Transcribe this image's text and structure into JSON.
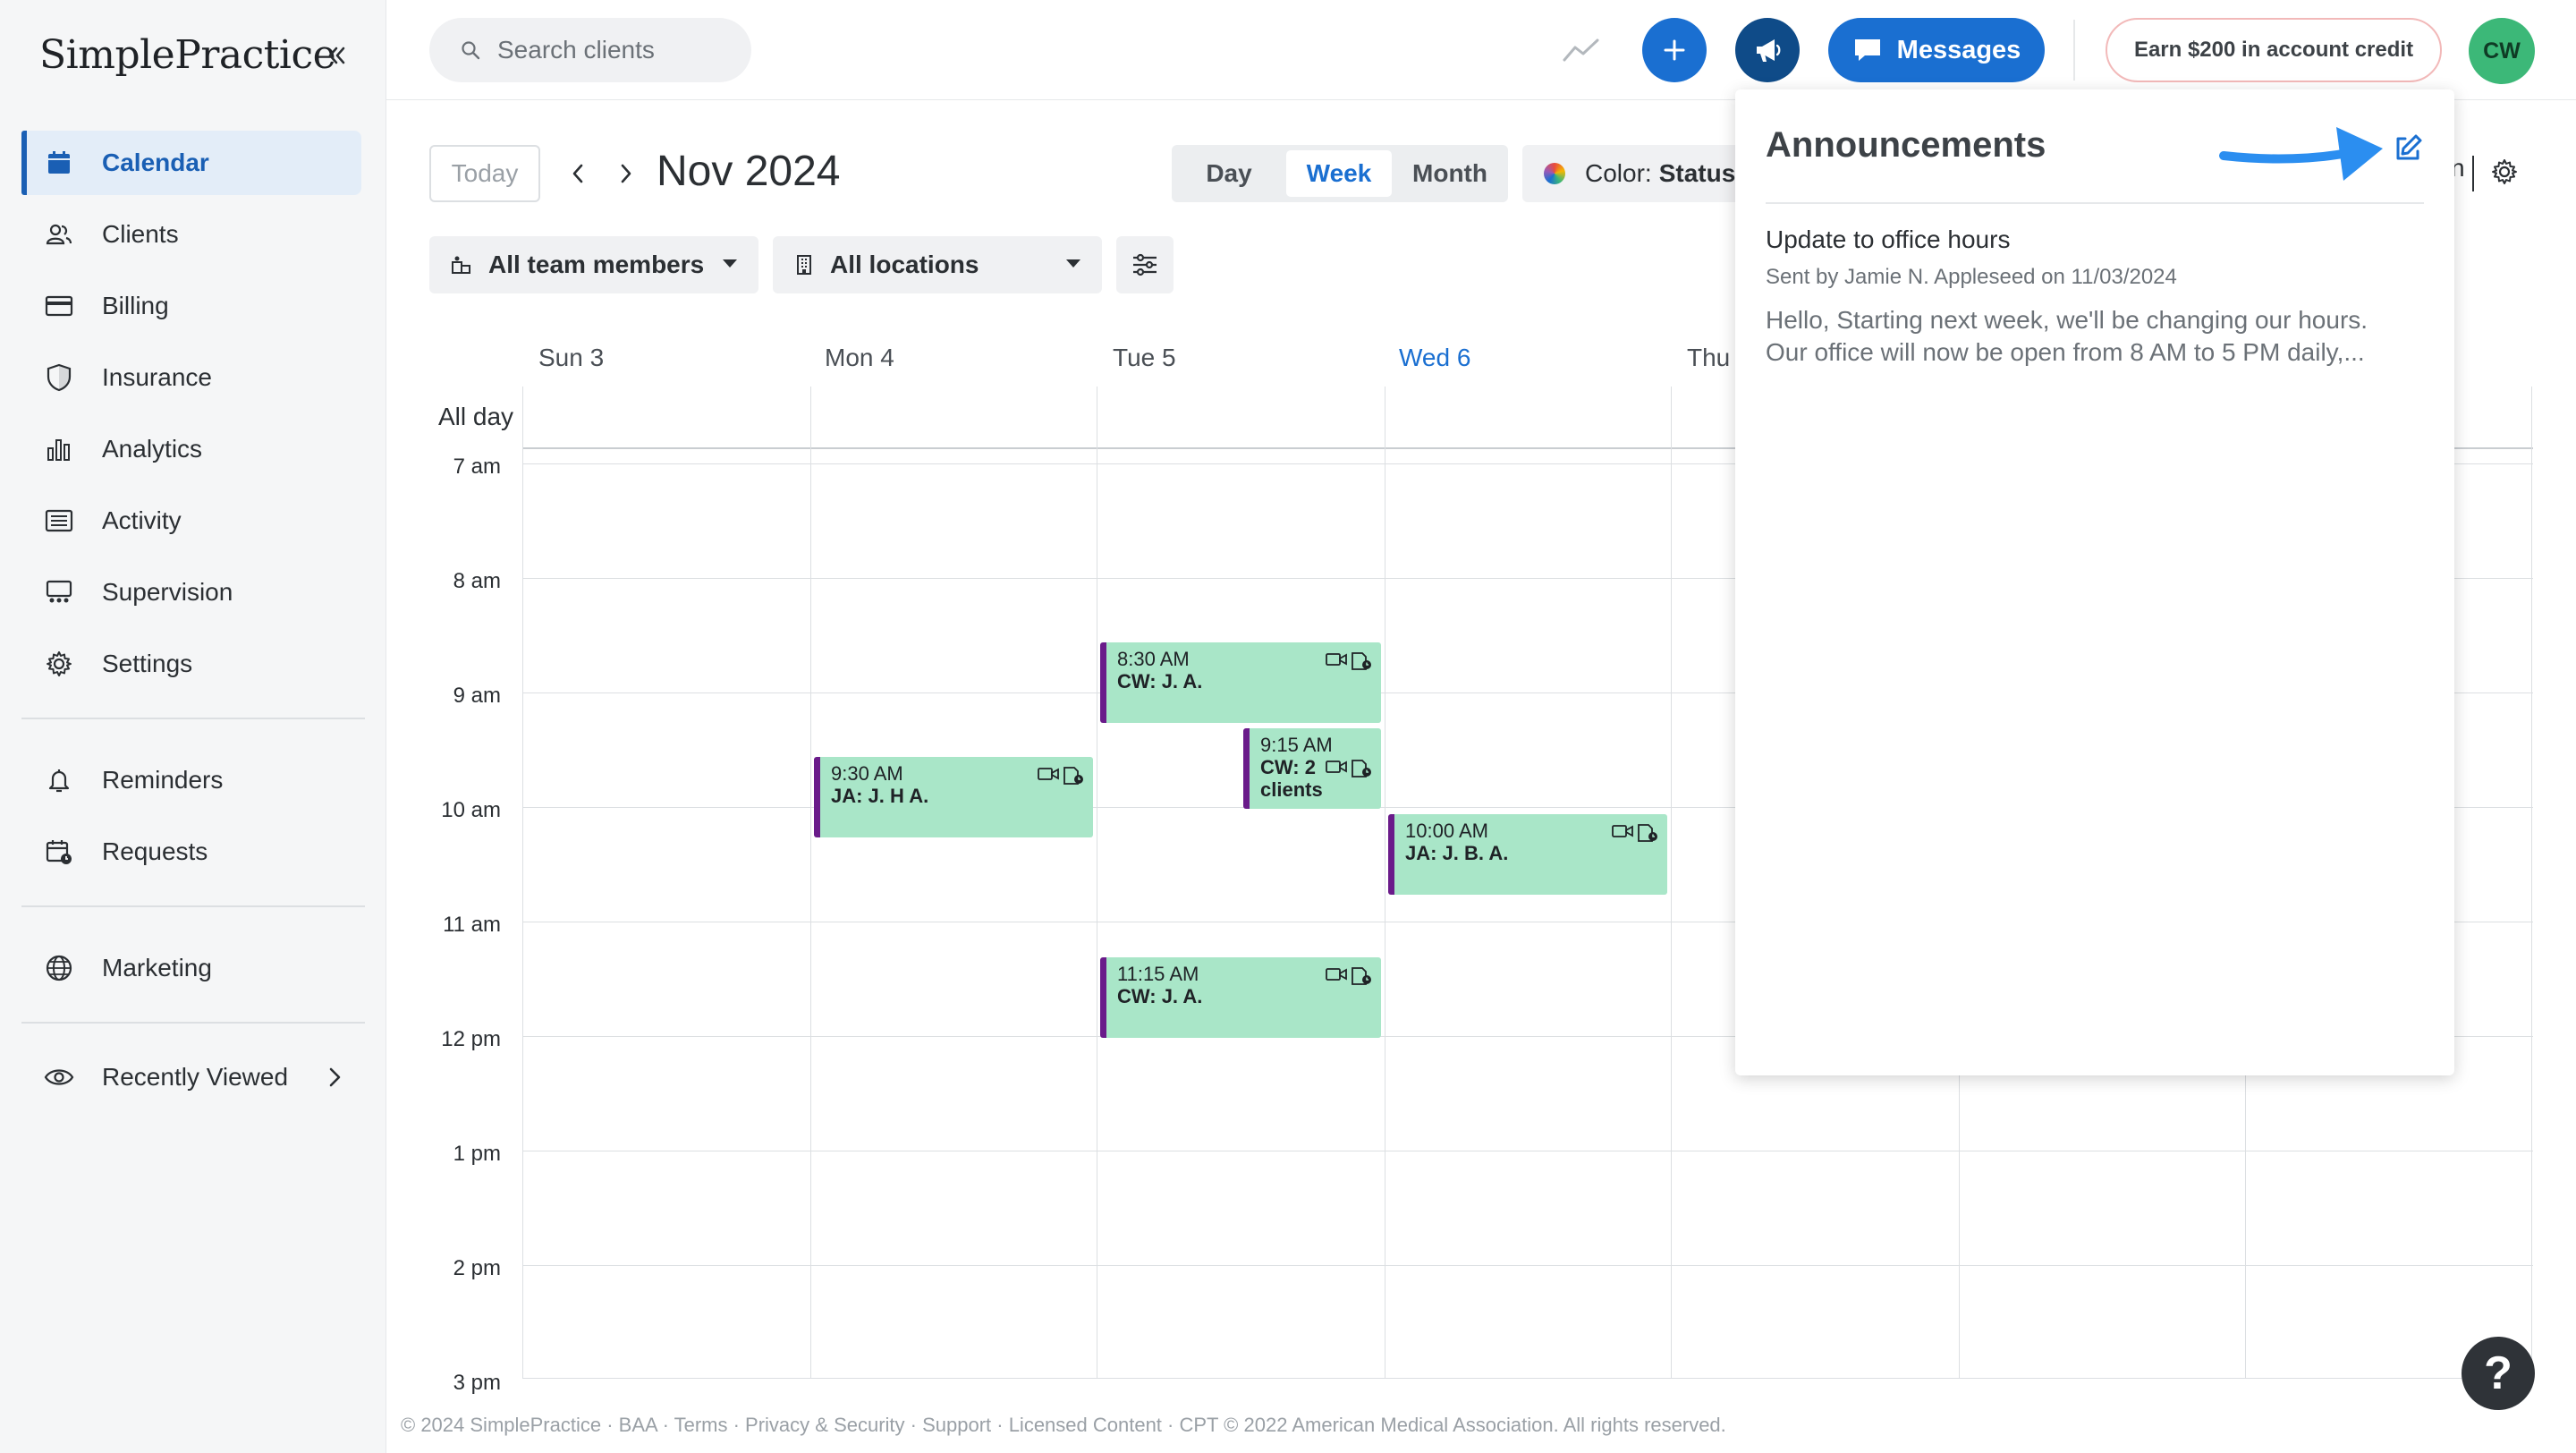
{
  "app": {
    "logo_text": "SimplePractice"
  },
  "sidebar": {
    "items": [
      {
        "label": "Calendar",
        "icon": "calendar-icon",
        "active": true
      },
      {
        "label": "Clients",
        "icon": "clients-icon"
      },
      {
        "label": "Billing",
        "icon": "billing-icon"
      },
      {
        "label": "Insurance",
        "icon": "shield-icon"
      },
      {
        "label": "Analytics",
        "icon": "bar-chart-icon"
      },
      {
        "label": "Activity",
        "icon": "list-icon"
      },
      {
        "label": "Supervision",
        "icon": "supervision-icon"
      },
      {
        "label": "Settings",
        "icon": "gear-icon"
      },
      {
        "label": "Reminders",
        "icon": "bell-icon"
      },
      {
        "label": "Requests",
        "icon": "calendar-request-icon"
      },
      {
        "label": "Marketing",
        "icon": "globe-icon"
      },
      {
        "label": "Recently Viewed",
        "icon": "eye-icon"
      }
    ]
  },
  "topbar": {
    "search_placeholder": "Search clients",
    "messages_label": "Messages",
    "credit_label": "Earn $200 in account credit",
    "avatar_initials": "CW"
  },
  "toolbar": {
    "today_label": "Today",
    "month_title": "Nov 2024",
    "views": [
      "Day",
      "Week",
      "Month"
    ],
    "active_view": "Week",
    "color_label": "Color:",
    "color_value": "Status",
    "team_filter": "All team members",
    "location_filter": "All locations",
    "partial_right_text": "n"
  },
  "calendar": {
    "days": [
      "Sun 3",
      "Mon 4",
      "Tue 5",
      "Wed 6",
      "Thu"
    ],
    "today": "Wed 6",
    "allday_label": "All day",
    "hours": [
      "7 am",
      "8 am",
      "9 am",
      "10 am",
      "11 am",
      "12 pm",
      "1 pm",
      "2 pm",
      "3 pm"
    ],
    "events": [
      {
        "time": "8:30 AM",
        "who": "CW: J. A."
      },
      {
        "time": "9:15 AM",
        "who": "CW: 2 clients"
      },
      {
        "time": "9:30 AM",
        "who": "JA: J. H A."
      },
      {
        "time": "10:00 AM",
        "who": "JA: J. B. A."
      },
      {
        "time": "11:15 AM",
        "who": "CW: J. A."
      }
    ],
    "event_colors": {
      "fill": "#a9e6c8",
      "accent": "#6a1b8a"
    }
  },
  "announcements": {
    "title": "Announcements",
    "item": {
      "title": "Update to office hours",
      "meta": "Sent by Jamie N. Appleseed on 11/03/2024",
      "body_line1": "Hello, Starting next week, we'll be changing our hours.",
      "body_line2": "Our office will now be open from 8 AM to 5 PM daily,..."
    }
  },
  "footer": {
    "text": "© 2024 SimplePractice · BAA · Terms · Privacy & Security · Support · Licensed Content · CPT © 2022 American Medical Association. All rights reserved."
  },
  "help_label": "?",
  "colors": {
    "primary": "#1a6fd1",
    "dark_primary": "#0f4b88",
    "avatar": "#3cb878",
    "annotation_arrow": "#2b8ef0"
  }
}
